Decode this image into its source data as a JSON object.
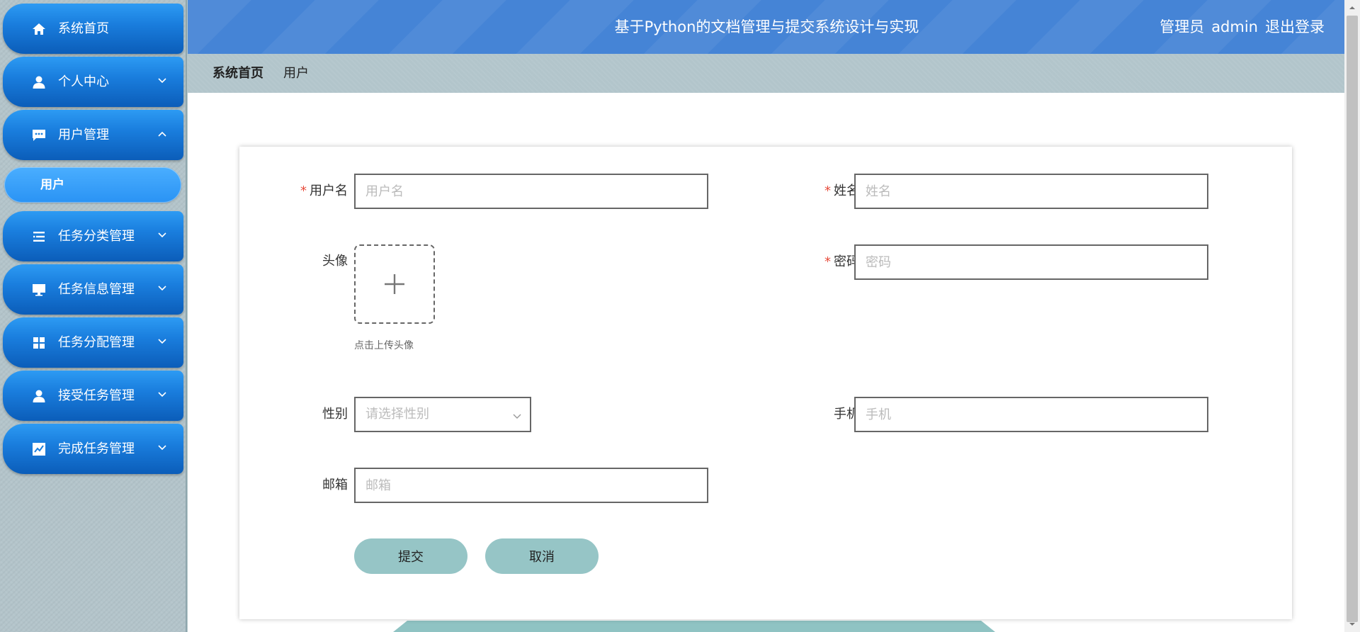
{
  "sidebar": {
    "items": [
      {
        "label": "系统首页",
        "icon": "home-icon"
      },
      {
        "label": "个人中心",
        "icon": "user-icon"
      },
      {
        "label": "用户管理",
        "icon": "chat-icon"
      },
      {
        "label": "任务分类管理",
        "icon": "list-icon"
      },
      {
        "label": "任务信息管理",
        "icon": "monitor-icon"
      },
      {
        "label": "任务分配管理",
        "icon": "grid-icon"
      },
      {
        "label": "接受任务管理",
        "icon": "user-icon"
      },
      {
        "label": "完成任务管理",
        "icon": "chart-icon"
      }
    ],
    "sub_item": {
      "label": "用户"
    }
  },
  "header": {
    "title": "基于Python的文档管理与提交系统设计与实现",
    "role": "管理员",
    "username": "admin",
    "logout": "退出登录"
  },
  "breadcrumb": {
    "home": "系统首页",
    "current": "用户"
  },
  "form": {
    "username": {
      "label": "用户名",
      "placeholder": "用户名",
      "required": true
    },
    "name": {
      "label": "姓名",
      "placeholder": "姓名",
      "required": true
    },
    "avatar": {
      "label": "头像",
      "tip": "点击上传头像"
    },
    "password": {
      "label": "密码",
      "placeholder": "密码",
      "required": true
    },
    "gender": {
      "label": "性别",
      "placeholder": "请选择性别"
    },
    "phone": {
      "label": "手机",
      "placeholder": "手机"
    },
    "email": {
      "label": "邮箱",
      "placeholder": "邮箱"
    },
    "required_mark": "*",
    "submit_label": "提交",
    "cancel_label": "取消"
  },
  "colors": {
    "header_bg": "#4584d6",
    "menu_gradient_top": "#2d9bf3",
    "menu_gradient_bottom": "#0b5db9",
    "button_bg": "#96c5c6",
    "required": "#e74c3c"
  }
}
